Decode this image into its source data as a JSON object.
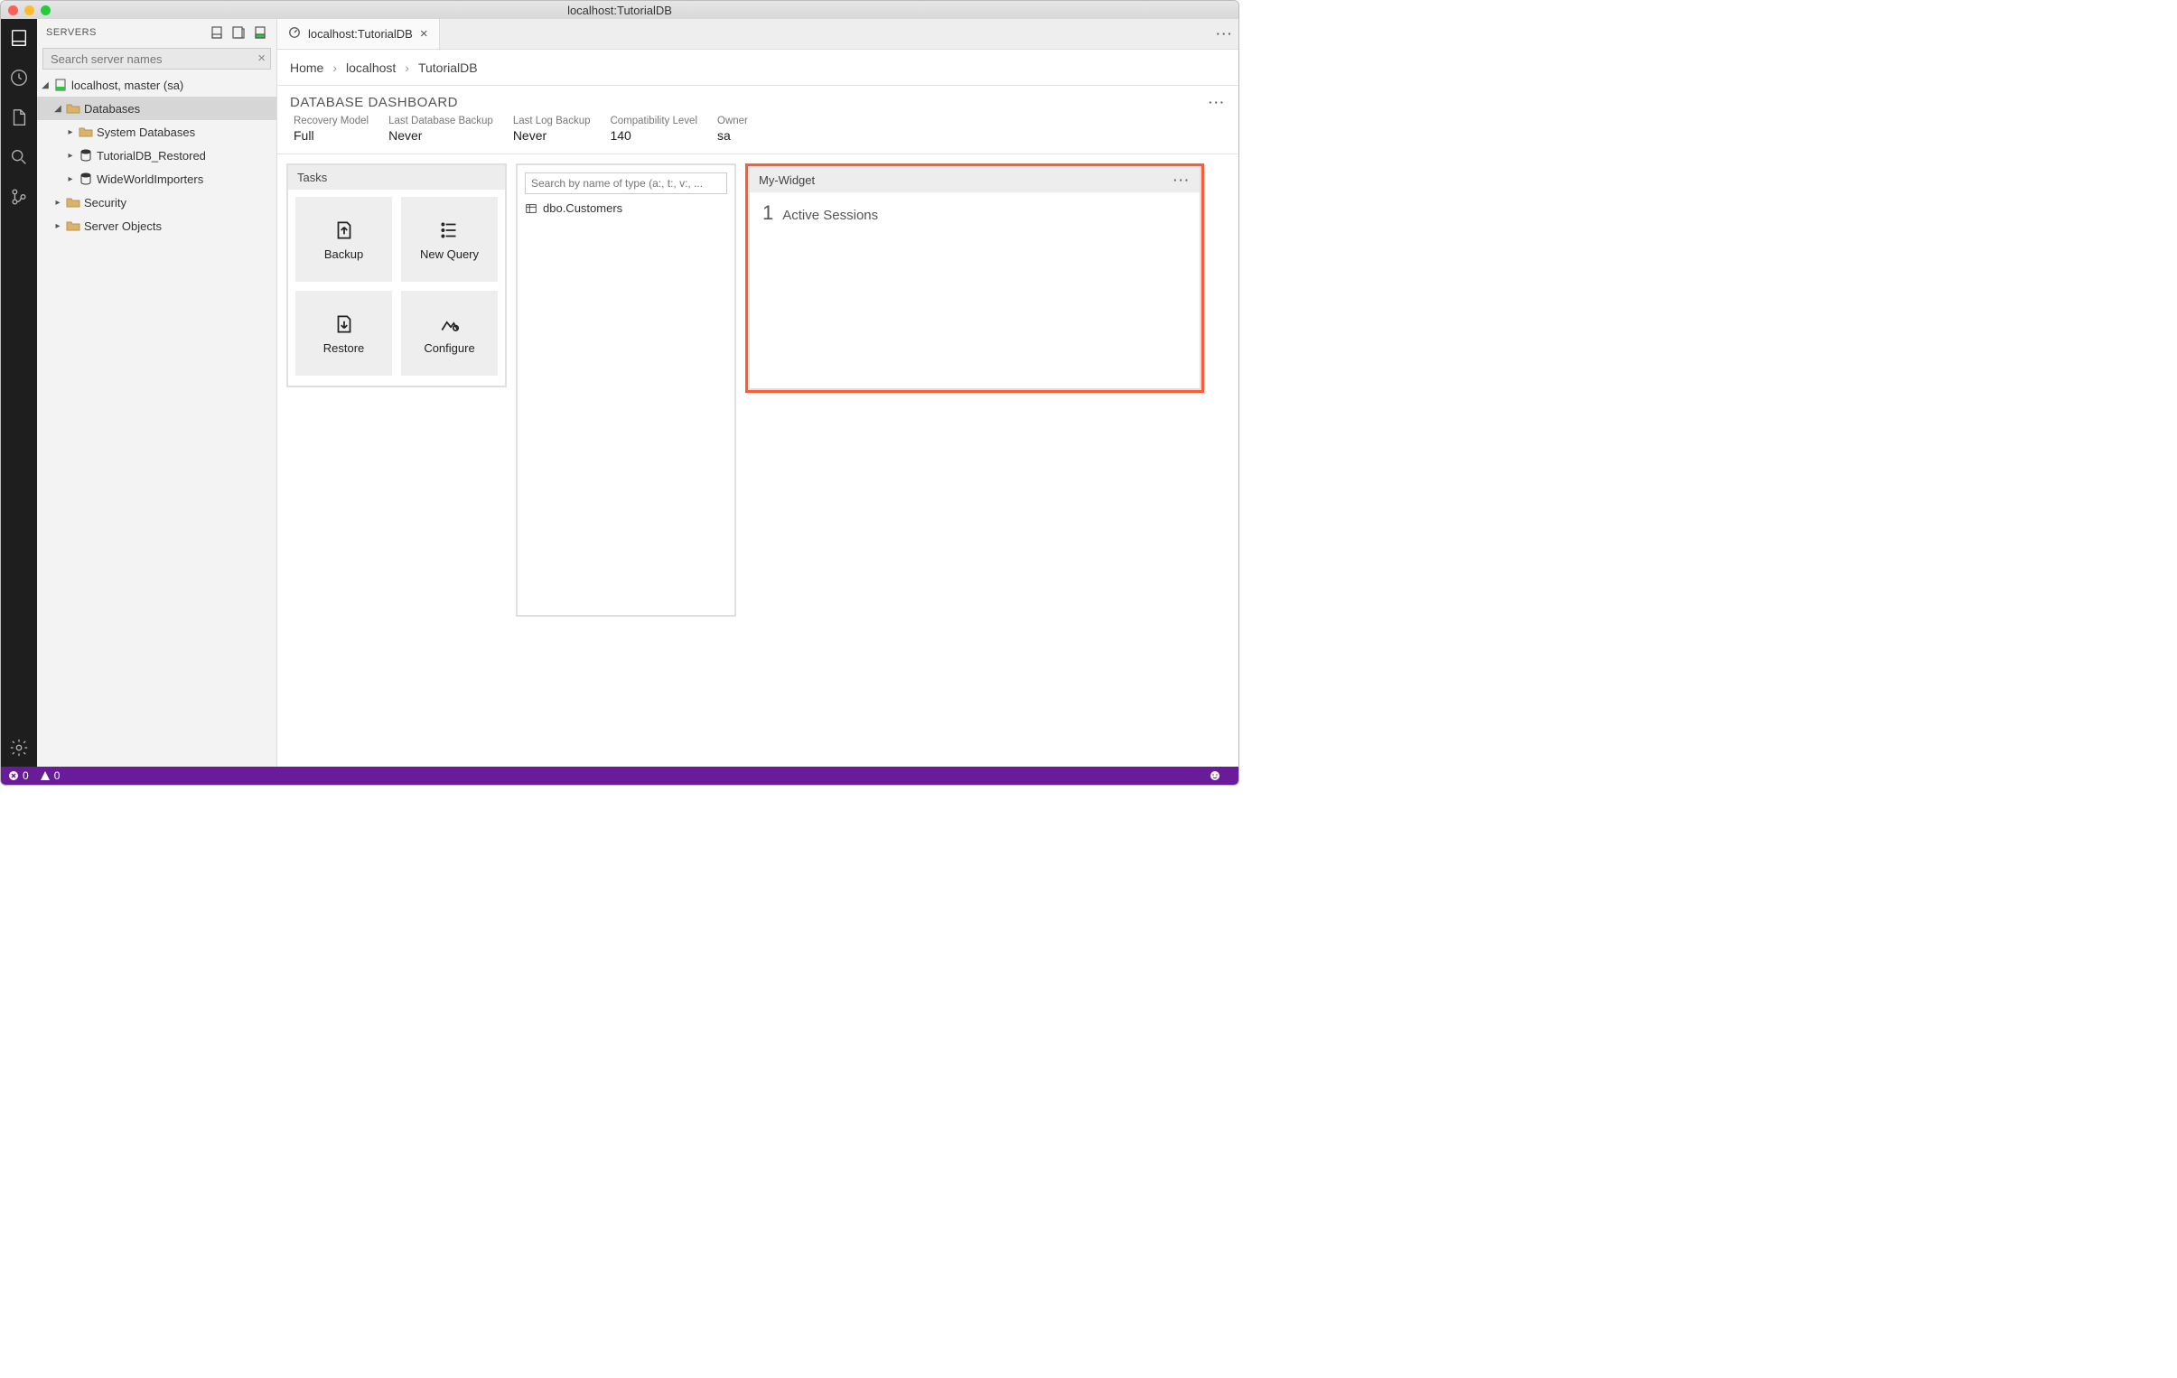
{
  "window": {
    "title": "localhost:TutorialDB"
  },
  "sidebar": {
    "title": "SERVERS",
    "search_placeholder": "Search server names",
    "tree": {
      "server": "localhost, master (sa)",
      "databases_label": "Databases",
      "system_db_label": "System Databases",
      "db1": "TutorialDB_Restored",
      "db2": "WideWorldImporters",
      "security_label": "Security",
      "server_objects_label": "Server Objects"
    }
  },
  "tab": {
    "label": "localhost:TutorialDB"
  },
  "breadcrumb": {
    "home": "Home",
    "server": "localhost",
    "db": "TutorialDB"
  },
  "dashboard": {
    "title": "DATABASE DASHBOARD",
    "props": [
      {
        "label": "Recovery Model",
        "value": "Full"
      },
      {
        "label": "Last Database Backup",
        "value": "Never"
      },
      {
        "label": "Last Log Backup",
        "value": "Never"
      },
      {
        "label": "Compatibility Level",
        "value": "140"
      },
      {
        "label": "Owner",
        "value": "sa"
      }
    ]
  },
  "tasks": {
    "title": "Tasks",
    "items": [
      {
        "label": "Backup"
      },
      {
        "label": "New Query"
      },
      {
        "label": "Restore"
      },
      {
        "label": "Configure"
      }
    ]
  },
  "object_search": {
    "placeholder": "Search by name of type (a:, t:, v:, ...",
    "results": [
      {
        "label": "dbo.Customers"
      }
    ]
  },
  "custom_widget": {
    "title": "My-Widget",
    "count": "1",
    "label": "Active Sessions"
  },
  "statusbar": {
    "errors": "0",
    "warnings": "0"
  }
}
